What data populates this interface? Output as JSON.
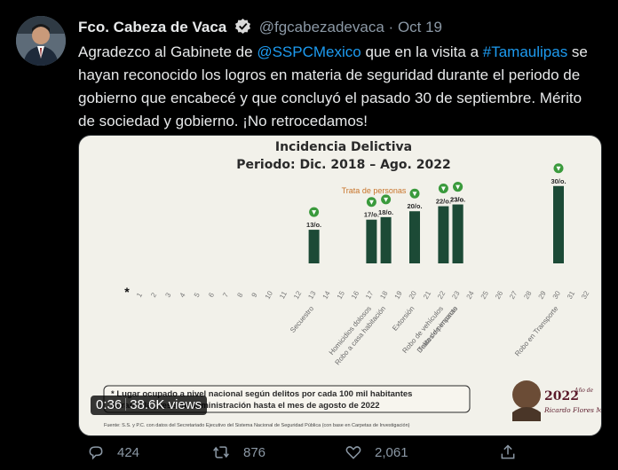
{
  "tweet": {
    "author_name": "Fco. Cabeza de Vaca",
    "handle": "@fgcabezadevaca",
    "dot": "·",
    "date": "Oct 19",
    "text_1": "Agradezco al Gabinete de ",
    "mention": "@SSPCMexico",
    "text_2": " que en la visita a ",
    "hashtag": "#Tamaulipas",
    "text_3": " se hayan reconocido los logros en materia de seguridad durante el periodo de gobierno que encabecé y que concluyó el pasado 30 de septiembre. Mérito de sociedad y gobierno. ¡No retrocedamos!"
  },
  "media": {
    "title_line1": "Incidencia Delictiva",
    "title_line2": "Periodo: Dic. 2018 – Ago. 2022",
    "trata_label": "Trata de personas",
    "footnote_line1": "* Lugar ocupado a nivel nacional según delitos por cada 100 mil habitantes",
    "footnote_line2": "durante la presente administración hasta el mes de agosto de 2022",
    "source": "Fuente: S.S. y P.C. con datos del Secretariado Ejecutivo del Sistema Nacional de Seguridad Pública (con base en Carpetas de Investigación)",
    "logo_year": "2022",
    "logo_text": "Ricardo Flores Magón",
    "logo_subtext": "Año de"
  },
  "video": {
    "time": "0:36",
    "views": "38.6K views"
  },
  "actions": {
    "replies": "424",
    "retweets": "876",
    "likes": "2,061"
  },
  "colors": {
    "bar": "#1c4a36",
    "marker": "#3a9a3c",
    "link": "#1d9bf0",
    "media_bg": "#f2f1ea"
  },
  "chart_data": {
    "type": "bar",
    "title": "Incidencia Delictiva",
    "subtitle": "Periodo: Dic. 2018 – Ago. 2022",
    "axis_ticks": [
      "*",
      "1",
      "2",
      "3",
      "4",
      "5",
      "6",
      "7",
      "8",
      "9",
      "10",
      "11",
      "12",
      "13",
      "14",
      "15",
      "16",
      "17",
      "18",
      "19",
      "20",
      "21",
      "22",
      "23",
      "24",
      "25",
      "26",
      "27",
      "28",
      "29",
      "30",
      "31",
      "32"
    ],
    "categories": [
      "Secuestro",
      "Homicidios dolosos",
      "Robo a casa habitación",
      "Extorsión",
      "Robo de vehículos",
      "Delitos de impacto",
      "Trata de personas",
      "Robo en Transporte"
    ],
    "rank_labels": [
      "13/o.",
      "17/o.",
      "18/o.",
      "20/o.",
      "22/o.",
      "23/o.",
      "23/o.",
      "30/o."
    ],
    "ranks": [
      13,
      17,
      18,
      20,
      22,
      23,
      23,
      30
    ],
    "bar_heights_relative": [
      0.4,
      0.52,
      0.55,
      0.62,
      0.68,
      0.7,
      0.7,
      0.92
    ]
  }
}
